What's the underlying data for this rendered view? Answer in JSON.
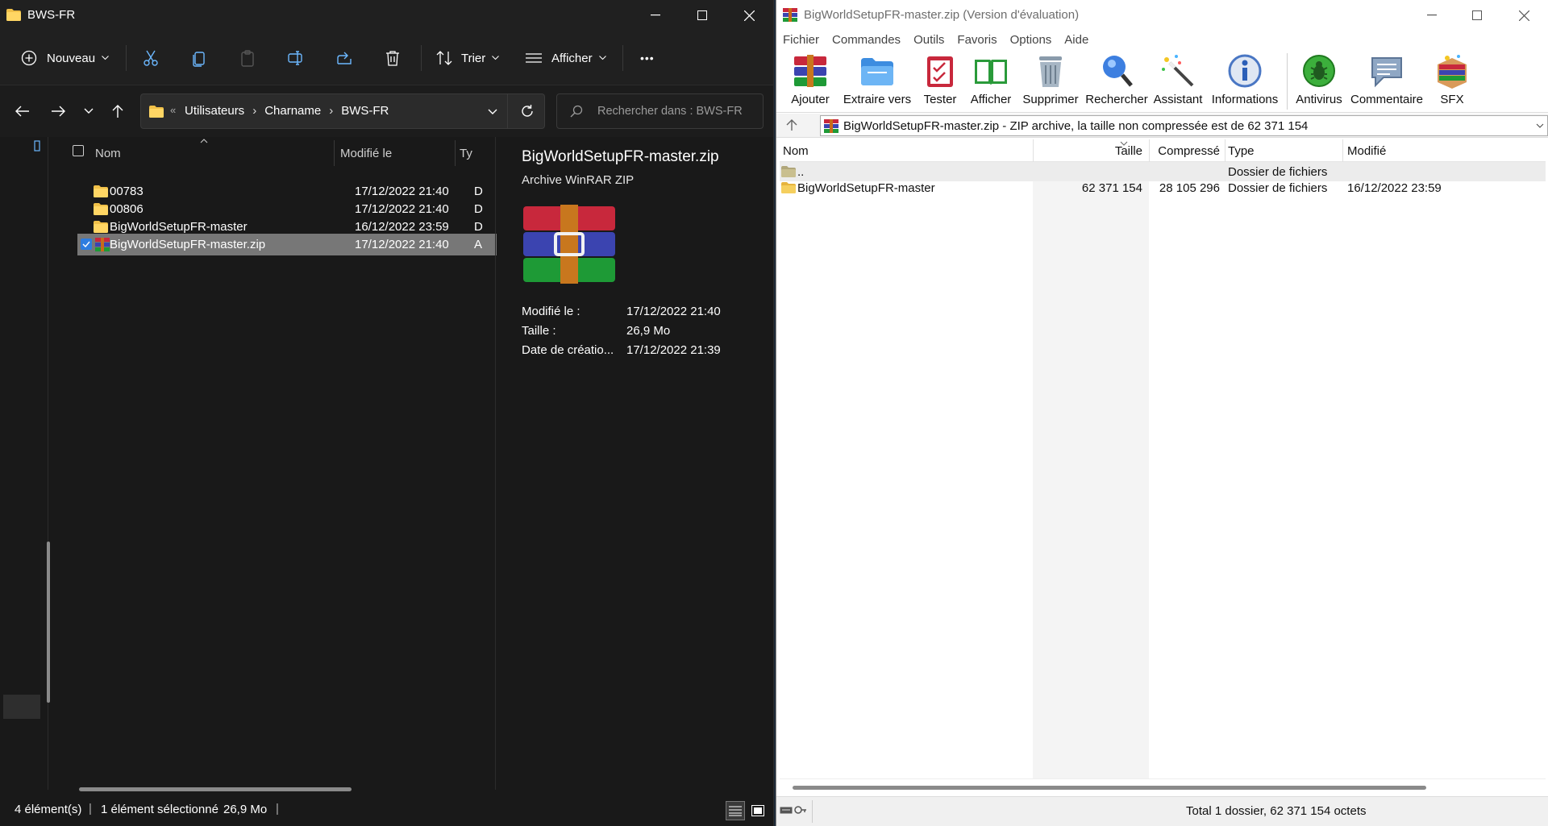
{
  "explorer": {
    "title": "BWS-FR",
    "toolbar": {
      "new_label": "Nouveau",
      "sort_label": "Trier",
      "view_label": "Afficher",
      "more": "•••"
    },
    "breadcrumb": [
      "Utilisateurs",
      "Charname",
      "BWS-FR"
    ],
    "search_placeholder": "Rechercher dans : BWS-FR",
    "columns": {
      "name": "Nom",
      "modified": "Modifié le",
      "type": "Ty"
    },
    "rows": [
      {
        "name": "00783",
        "modified": "17/12/2022 21:40",
        "type": "D",
        "kind": "folder"
      },
      {
        "name": "00806",
        "modified": "17/12/2022 21:40",
        "type": "D",
        "kind": "folder"
      },
      {
        "name": "BigWorldSetupFR-master",
        "modified": "16/12/2022 23:59",
        "type": "D",
        "kind": "folder"
      },
      {
        "name": "BigWorldSetupFR-master.zip",
        "modified": "17/12/2022 21:40",
        "type": "A",
        "kind": "zip"
      }
    ],
    "preview": {
      "filename": "BigWorldSetupFR-master.zip",
      "filetype": "Archive WinRAR ZIP",
      "details": [
        {
          "label": "Modifié le :",
          "value": "17/12/2022 21:40"
        },
        {
          "label": "Taille :",
          "value": "26,9 Mo"
        },
        {
          "label": "Date de créatio...",
          "value": "17/12/2022 21:39"
        }
      ]
    },
    "status": {
      "count": "4 élément(s)",
      "selected": "1 élément sélectionné",
      "size": "26,9 Mo"
    }
  },
  "winrar": {
    "title": "BigWorldSetupFR-master.zip (Version d'évaluation)",
    "menu": [
      "Fichier",
      "Commandes",
      "Outils",
      "Favoris",
      "Options",
      "Aide"
    ],
    "tools": [
      {
        "label": "Ajouter",
        "icon": "add-books-icon"
      },
      {
        "label": "Extraire vers",
        "icon": "folder-extract-icon"
      },
      {
        "label": "Tester",
        "icon": "clipboard-check-icon"
      },
      {
        "label": "Afficher",
        "icon": "book-view-icon"
      },
      {
        "label": "Supprimer",
        "icon": "trash-icon"
      },
      {
        "label": "Rechercher",
        "icon": "magnifier-icon"
      },
      {
        "label": "Assistant",
        "icon": "magic-wand-icon"
      },
      {
        "label": "Informations",
        "icon": "info-icon"
      },
      {
        "label": "Antivirus",
        "icon": "bug-icon"
      },
      {
        "label": "Commentaire",
        "icon": "comment-icon"
      },
      {
        "label": "SFX",
        "icon": "sfx-box-icon"
      }
    ],
    "path_text": "BigWorldSetupFR-master.zip - ZIP archive, la taille non compressée est de 62 371 154",
    "columns": {
      "name": "Nom",
      "size": "Taille",
      "packed": "Compressé",
      "type": "Type",
      "modified": "Modifié"
    },
    "rows": [
      {
        "name": "..",
        "size": "",
        "packed": "",
        "type": "Dossier de fichiers",
        "modified": ""
      },
      {
        "name": "BigWorldSetupFR-master",
        "size": "62 371 154",
        "packed": "28 105 296",
        "type": "Dossier de fichiers",
        "modified": "16/12/2022 23:59"
      }
    ],
    "status": "Total 1 dossier, 62 371 154 octets"
  }
}
